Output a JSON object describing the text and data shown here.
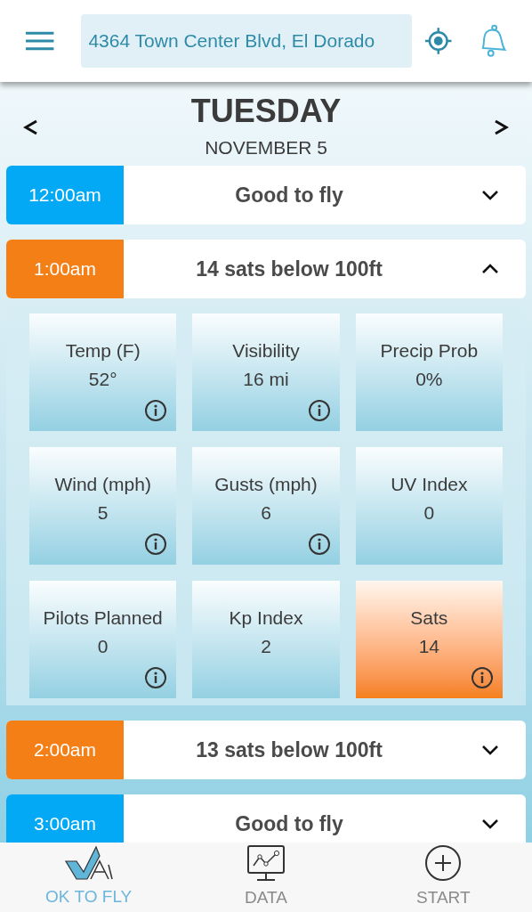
{
  "header": {
    "address": "4364 Town Center Blvd, El Dorado"
  },
  "day": {
    "weekday": "TUESDAY",
    "date": "NOVEMBER 5"
  },
  "hours": [
    {
      "time": "12:00am",
      "status": "Good to fly",
      "kind": "ok",
      "expanded": false
    },
    {
      "time": "1:00am",
      "status": "14 sats below 100ft",
      "kind": "warn",
      "expanded": true,
      "tiles": [
        {
          "label": "Temp (F)",
          "value": "52°",
          "info": true,
          "alert": false
        },
        {
          "label": "Visibility",
          "value": "16 mi",
          "info": true,
          "alert": false
        },
        {
          "label": "Precip Prob",
          "value": "0%",
          "info": false,
          "alert": false
        },
        {
          "label": "Wind (mph)",
          "value": "5",
          "info": true,
          "alert": false
        },
        {
          "label": "Gusts (mph)",
          "value": "6",
          "info": true,
          "alert": false
        },
        {
          "label": "UV Index",
          "value": "0",
          "info": false,
          "alert": false
        },
        {
          "label": "Pilots Planned",
          "value": "0",
          "info": true,
          "alert": false
        },
        {
          "label": "Kp Index",
          "value": "2",
          "info": false,
          "alert": false
        },
        {
          "label": "Sats",
          "value": "14",
          "info": true,
          "alert": true
        }
      ]
    },
    {
      "time": "2:00am",
      "status": "13 sats below 100ft",
      "kind": "warn",
      "expanded": false
    },
    {
      "time": "3:00am",
      "status": "Good to fly",
      "kind": "ok",
      "expanded": false
    }
  ],
  "nav": [
    {
      "label": "OK TO FLY",
      "kind": "fly",
      "selected": true
    },
    {
      "label": "DATA",
      "kind": "data",
      "selected": false
    },
    {
      "label": "START",
      "kind": "start",
      "selected": false
    }
  ]
}
